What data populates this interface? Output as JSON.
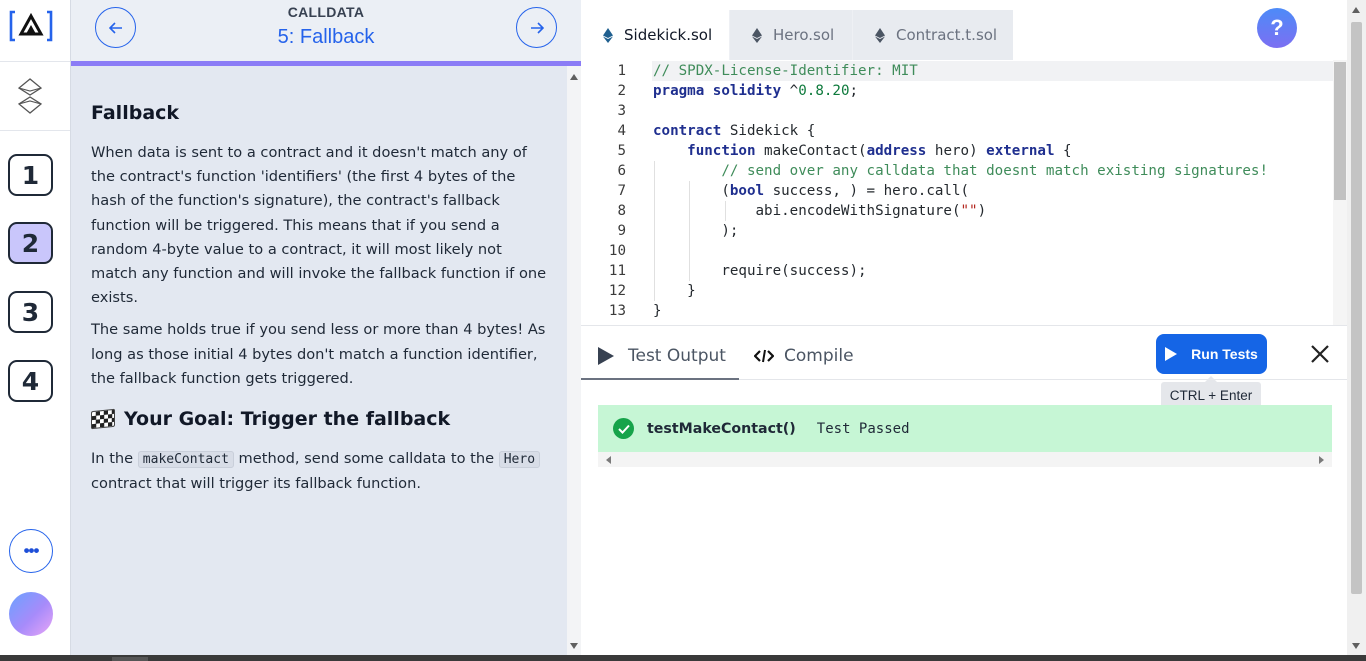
{
  "header": {
    "kicker": "CALLDATA",
    "title": "5: Fallback"
  },
  "sidebar": {
    "stages": [
      "1",
      "2",
      "3",
      "4"
    ],
    "active_stage": "2",
    "more_label": "•••"
  },
  "lesson": {
    "heading": "Fallback",
    "p1": "When data is sent to a contract and it doesn't match any of the contract's function 'identifiers' (the first 4 bytes of the hash of the function's signature), the contract's fallback function will be triggered. This means that if you send a random 4-byte value to a contract, it will most likely not match any function and will invoke the fallback function if one exists.",
    "p2": "The same holds true if you send less or more than 4 bytes! As long as those initial 4 bytes don't match a function identifier, the fallback function gets triggered.",
    "goal_heading": "Your Goal: Trigger the fallback",
    "goal_text_1": "In the",
    "goal_code_1": "makeContact",
    "goal_text_2": "method, send some calldata to the",
    "goal_code_2": "Hero",
    "goal_text_3": "contract that will trigger its fallback function."
  },
  "editor": {
    "tabs": [
      "Sidekick.sol",
      "Hero.sol",
      "Contract.t.sol"
    ],
    "active_tab": "Sidekick.sol",
    "line_numbers": [
      "1",
      "2",
      "3",
      "4",
      "5",
      "6",
      "7",
      "8",
      "9",
      "10",
      "11",
      "12",
      "13"
    ],
    "help_label": "?"
  },
  "output": {
    "tabs": [
      "Test Output",
      "Compile"
    ],
    "run_label": "Run Tests",
    "shortcut_hint": "CTRL + Enter",
    "test_name": "testMakeContact()",
    "test_status": "Test Passed"
  }
}
